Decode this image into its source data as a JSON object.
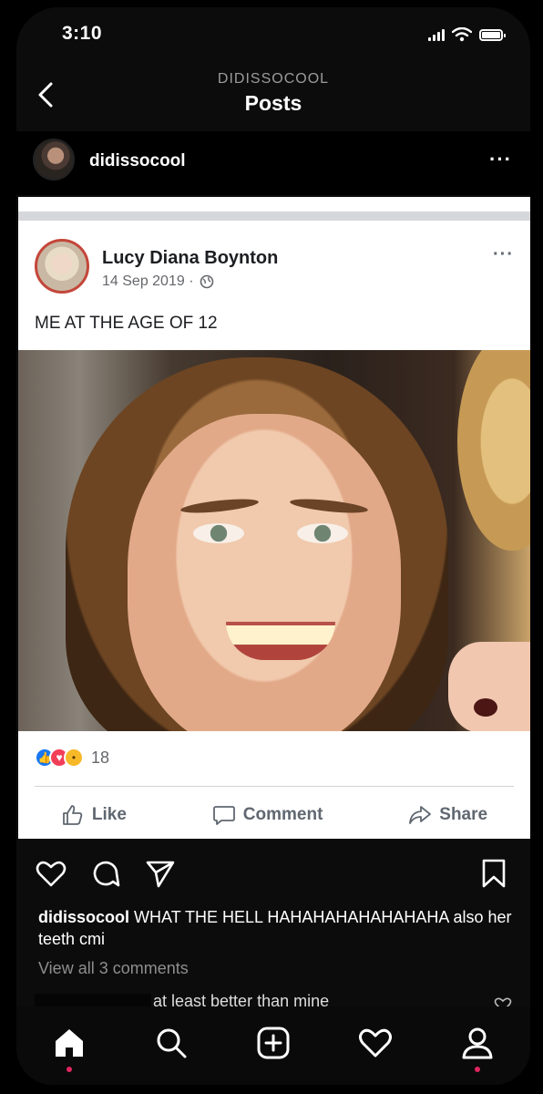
{
  "status_bar": {
    "time": "3:10"
  },
  "header": {
    "account": "DIDISSOCOOL",
    "title": "Posts"
  },
  "post": {
    "username": "didissocool",
    "more": "···",
    "caption_user": "didissocool",
    "caption_text": "WHAT THE HELL HAHAHAHAHAHAHAHA also her teeth cmi",
    "view_comments": "View all 3 comments",
    "comment_text": "at least better than mine"
  },
  "fb_post": {
    "name": "Lucy Diana Boynton",
    "date": "14 Sep 2019 ·",
    "more": "···",
    "text": "ME AT THE AGE OF 12",
    "reaction_count": "18",
    "actions": {
      "like": "Like",
      "comment": "Comment",
      "share": "Share"
    }
  },
  "colors": {
    "fb_blue": "#1877f2",
    "fb_love": "#f33e58",
    "fb_wow": "#f7b928",
    "tab_dot": "#e0245e"
  },
  "icons": {
    "header": "chevron-left-icon",
    "post_actions": [
      "heart-icon",
      "comment-icon",
      "send-icon",
      "bookmark-icon"
    ],
    "tabs": [
      "home-icon",
      "search-icon",
      "add-post-icon",
      "heart-icon",
      "profile-icon"
    ]
  }
}
